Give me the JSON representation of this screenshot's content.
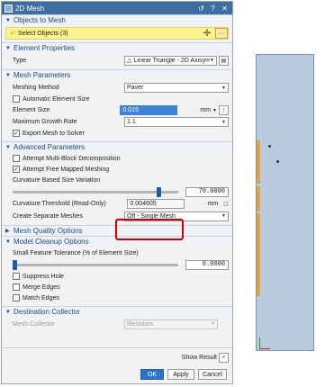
{
  "dialog": {
    "title": "2D Mesh",
    "title_btn_reset": "↺",
    "title_btn_help": "?",
    "title_btn_close": "✕"
  },
  "sections": {
    "objects": "Objects to Mesh",
    "element_props": "Element Properties",
    "mesh_params": "Mesh Parameters",
    "advanced": "Advanced Parameters",
    "quality": "Mesh Quality Options",
    "cleanup": "Model Cleanup Options",
    "destination": "Destination Collector"
  },
  "objects": {
    "select_label": "Select Objects (3)",
    "dots": "···"
  },
  "element_props": {
    "type_label": "Type",
    "type_value": "Linear Triangle - 2D Axisymm"
  },
  "mesh_params": {
    "method_label": "Meshing Method",
    "method_value": "Paver",
    "auto_size_label": "Automatic Element Size",
    "size_label": "Element Size",
    "size_value": "0.015",
    "size_unit": "mm",
    "growth_label": "Maximum Growth Rate",
    "growth_value": "1.1",
    "export_label": "Export Mesh to Solver"
  },
  "advanced": {
    "multi_block_label": "Attempt Multi-Block Decomposition",
    "free_mapped_label": "Attempt Free Mapped Meshing",
    "curvature_label": "Curvature Based Size Variation",
    "curvature_value": "70.0000",
    "threshold_label": "Curvature Threshold (Read-Only)",
    "threshold_value": "0.004605",
    "threshold_unit": "mm",
    "separate_label": "Create Separate Meshes",
    "separate_value": "Off - Single Mesh"
  },
  "cleanup": {
    "tolerance_label": "Small Feature Tolerance (% of Element Size)",
    "tolerance_value": "0.0000",
    "suppress_label": "Suppress Hole",
    "merge_label": "Merge Edges",
    "match_label": "Match Edges"
  },
  "destination": {
    "collector_label": "Mesh Collector",
    "collector_value": "Resistors"
  },
  "footer": {
    "show_result": "Show Result",
    "ok": "OK",
    "apply": "Apply",
    "cancel": "Cancel"
  },
  "sliders": {
    "curvature_fraction": 0.88,
    "tolerance_fraction": 0.0
  },
  "colors": {
    "accent": "#2f73c9",
    "highlight_yellow": "#fbf38c",
    "callout_red": "#d10000",
    "mesh_blue": "#b8cadd",
    "mesh_orange": "#e8a23a"
  }
}
